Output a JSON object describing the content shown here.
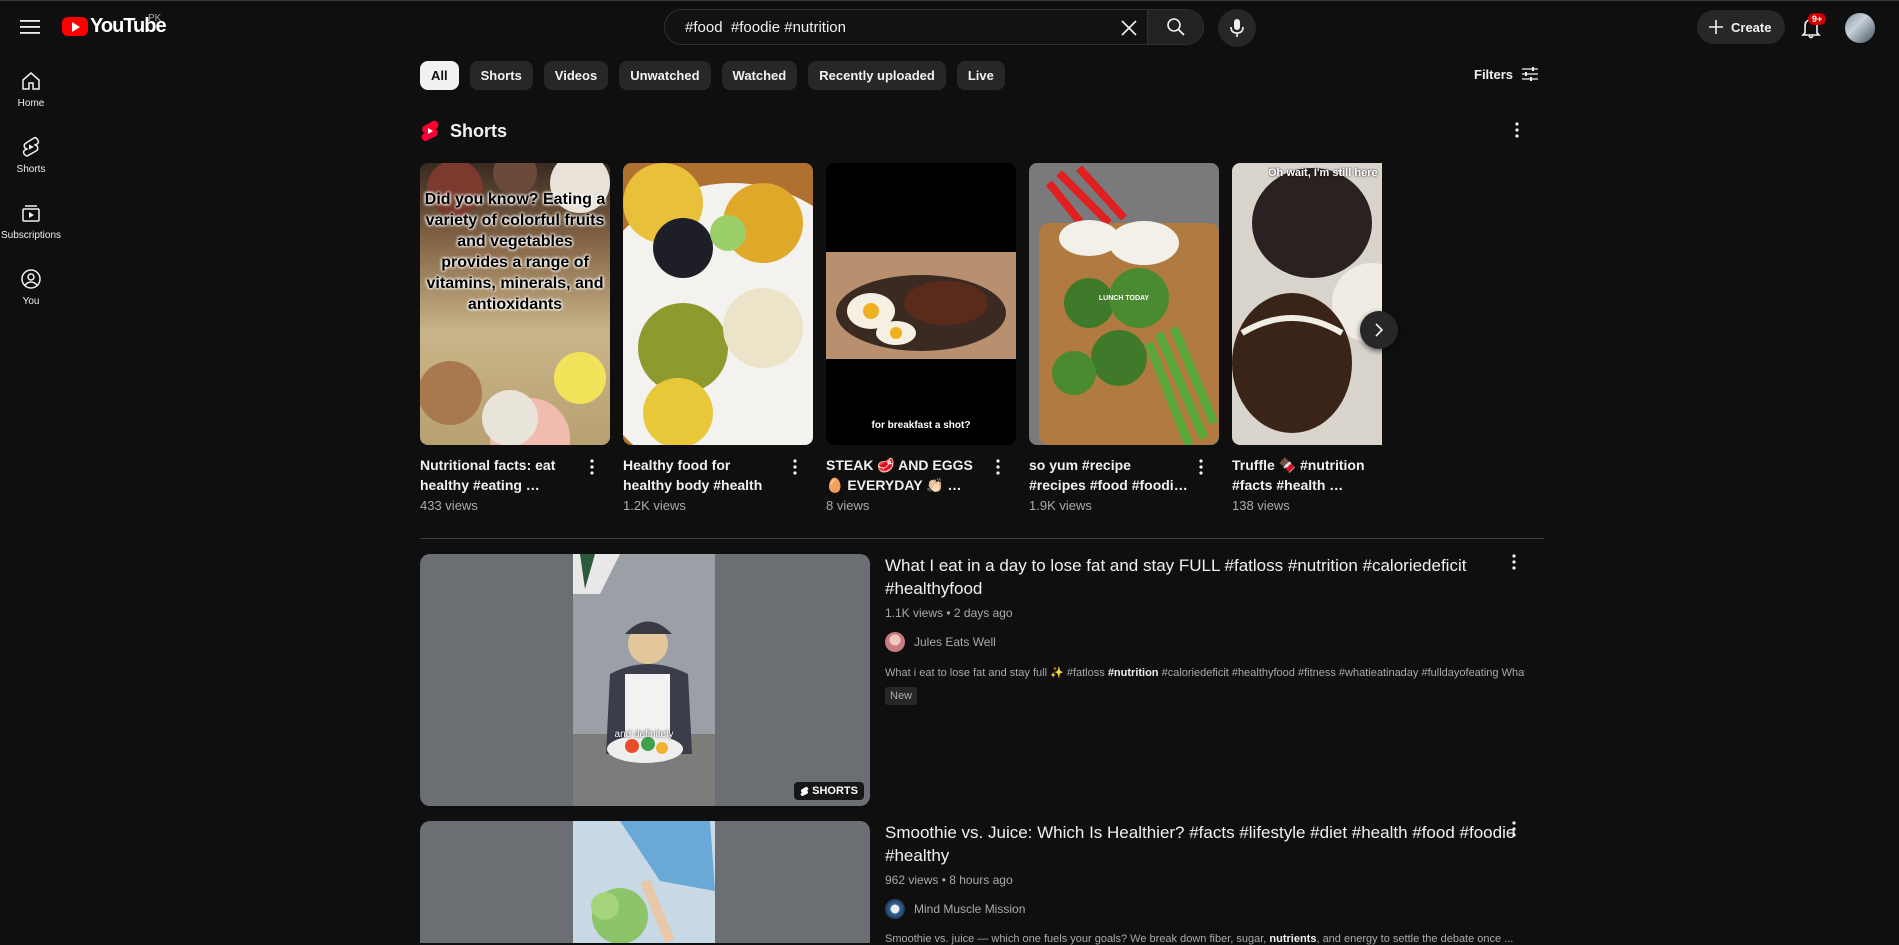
{
  "header": {
    "logo_text": "YouTube",
    "country": "PK",
    "search_value": "#food  #foodie #nutrition",
    "create_label": "Create",
    "notification_count": "9+"
  },
  "sidebar": {
    "items": [
      {
        "label": "Home",
        "icon": "home-icon"
      },
      {
        "label": "Shorts",
        "icon": "shorts-icon"
      },
      {
        "label": "Subscriptions",
        "icon": "subscriptions-icon"
      },
      {
        "label": "You",
        "icon": "you-icon"
      }
    ]
  },
  "chips": [
    "All",
    "Shorts",
    "Videos",
    "Unwatched",
    "Watched",
    "Recently uploaded",
    "Live"
  ],
  "filters_label": "Filters",
  "shorts_section": {
    "title": "Shorts",
    "items": [
      {
        "title": "Nutritional facts: eat healthy #eating …",
        "views": "433 views",
        "overlay": "Did you know? Eating a variety of colorful fruits and vegetables provides a range of vitamins, minerals, and antioxidants"
      },
      {
        "title": "Healthy food for healthy body #health #food …",
        "views": "1.2K views"
      },
      {
        "title": "STEAK 🥩 AND EGGS 🥚 EVERYDAY 👏🏻 …",
        "views": "8 views",
        "overlay": "for breakfast a shot?"
      },
      {
        "title": "so yum #recipe #recipes #food #foodi…",
        "views": "1.9K views",
        "overlay": "LUNCH TODAY"
      },
      {
        "title": "Truffle 🍫 #nutrition #facts #health …",
        "views": "138 views",
        "overlay": "Oh wait, I'm still here"
      }
    ]
  },
  "videos": [
    {
      "title": "What I eat in a day to lose fat and stay FULL #fatloss #nutrition #caloriedeficit #healthyfood",
      "meta": "1.1K views • 2 days ago",
      "channel": "Jules Eats Well",
      "desc_pre": "What i eat to lose fat and stay full ✨ #fatloss ",
      "desc_bold": "#nutrition",
      "desc_post": " #caloriedeficit #healthyfood #fitness #whatieatinaday #fulldayofeating What ...",
      "badge": "New",
      "thumb_caption": "and definitely",
      "tag": "SHORTS"
    },
    {
      "title": "Smoothie vs. Juice: Which Is Healthier? #facts #lifestyle #diet #health #food #foodie #healthy",
      "meta": "962 views • 8 hours ago",
      "channel": "Mind Muscle Mission",
      "desc_pre": "Smoothie vs. juice — which one fuels your goals? We break down fiber, sugar, ",
      "desc_bold": "nutrients",
      "desc_post": ", and energy to settle the debate once ..."
    }
  ]
}
